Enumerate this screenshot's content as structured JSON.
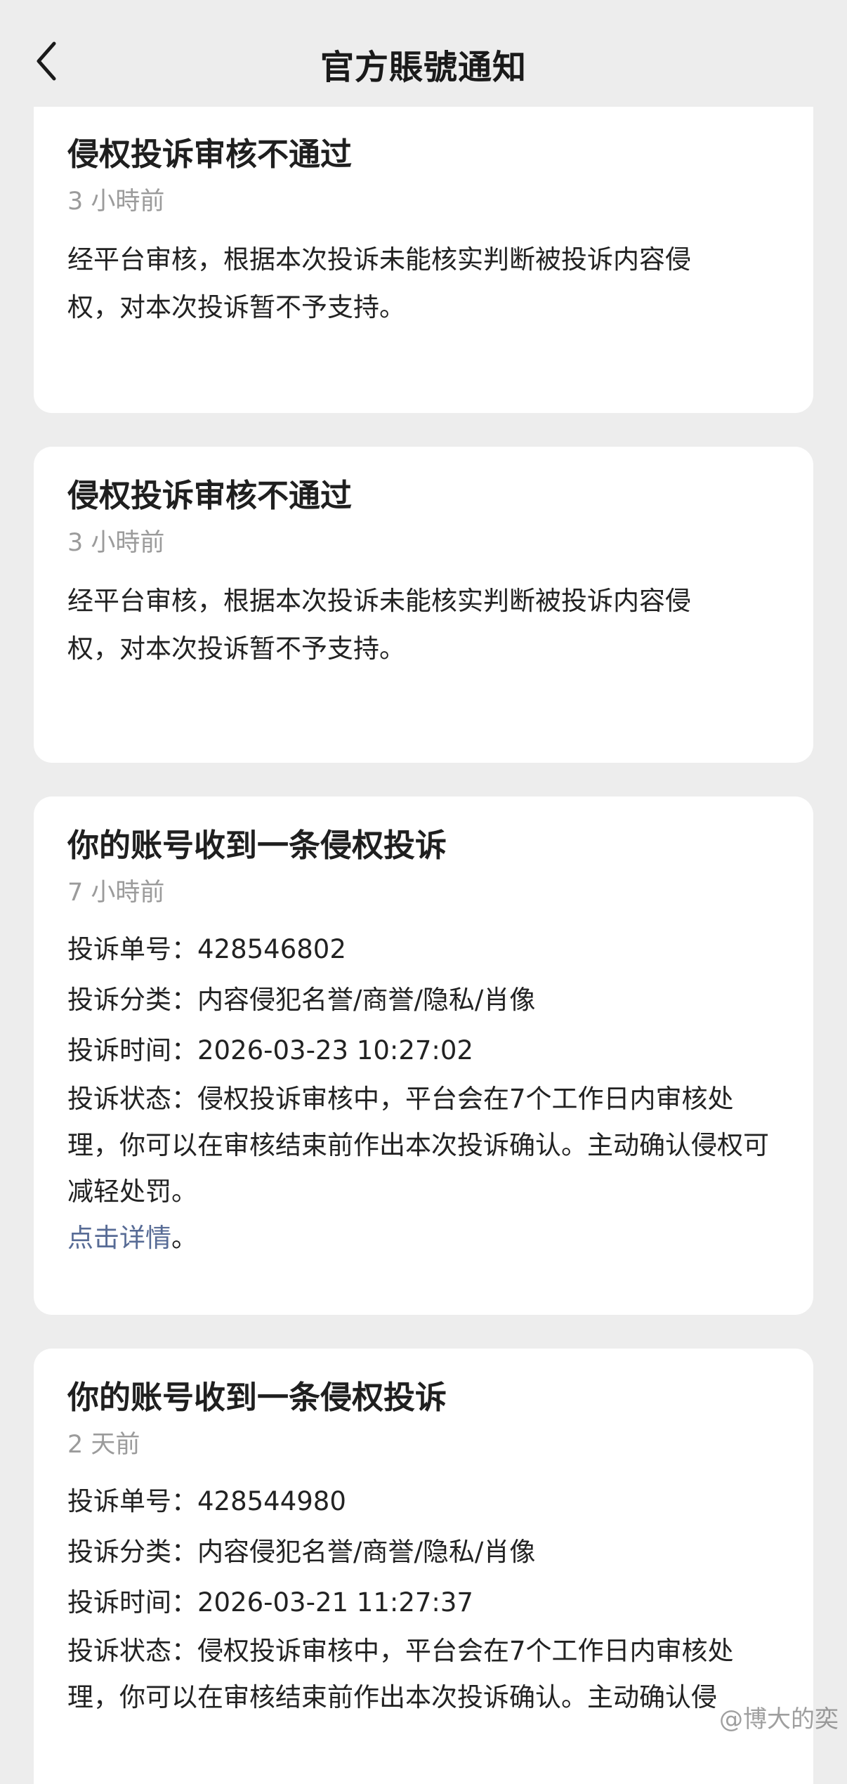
{
  "header": {
    "title": "官方賬號通知"
  },
  "cards": [
    {
      "title": "侵权投诉审核不通过",
      "time": "3 小時前",
      "body": "经平台审核，根据本次投诉未能核实判断被投诉内容侵权，对本次投诉暂不予支持。"
    },
    {
      "title": "侵权投诉审核不通过",
      "time": "3 小時前",
      "body": "经平台审核，根据本次投诉未能核实判断被投诉内容侵权，对本次投诉暂不予支持。"
    },
    {
      "title": "你的账号收到一条侵权投诉",
      "time": "7 小時前",
      "fields": [
        {
          "label": "投诉单号：",
          "value": "428546802"
        },
        {
          "label": "投诉分类：",
          "value": "内容侵犯名誉/商誉/隐私/肖像"
        },
        {
          "label": "投诉时间：",
          "value": "2026-03-23 10:27:02"
        },
        {
          "label": "投诉状态：",
          "value": "侵权投诉审核中，平台会在7个工作日内审核处理，你可以在审核结束前作出本次投诉确认。主动确认侵权可减轻处罚。"
        }
      ],
      "link": "点击详情",
      "link_suffix": "。"
    },
    {
      "title": "你的账号收到一条侵权投诉",
      "time": "2 天前",
      "fields": [
        {
          "label": "投诉单号：",
          "value": "428544980"
        },
        {
          "label": "投诉分类：",
          "value": "内容侵犯名誉/商誉/隐私/肖像"
        },
        {
          "label": "投诉时间：",
          "value": "2026-03-21 11:27:37"
        },
        {
          "label": "投诉状态：",
          "value": "侵权投诉审核中，平台会在7个工作日内审核处理，你可以在审核结束前作出本次投诉确认。主动确认侵"
        }
      ]
    }
  ],
  "watermark": "@博大的奕",
  "colors": {
    "background": "#ededed",
    "card": "#ffffff",
    "link": "#576b95",
    "time": "#9b9b9b"
  }
}
